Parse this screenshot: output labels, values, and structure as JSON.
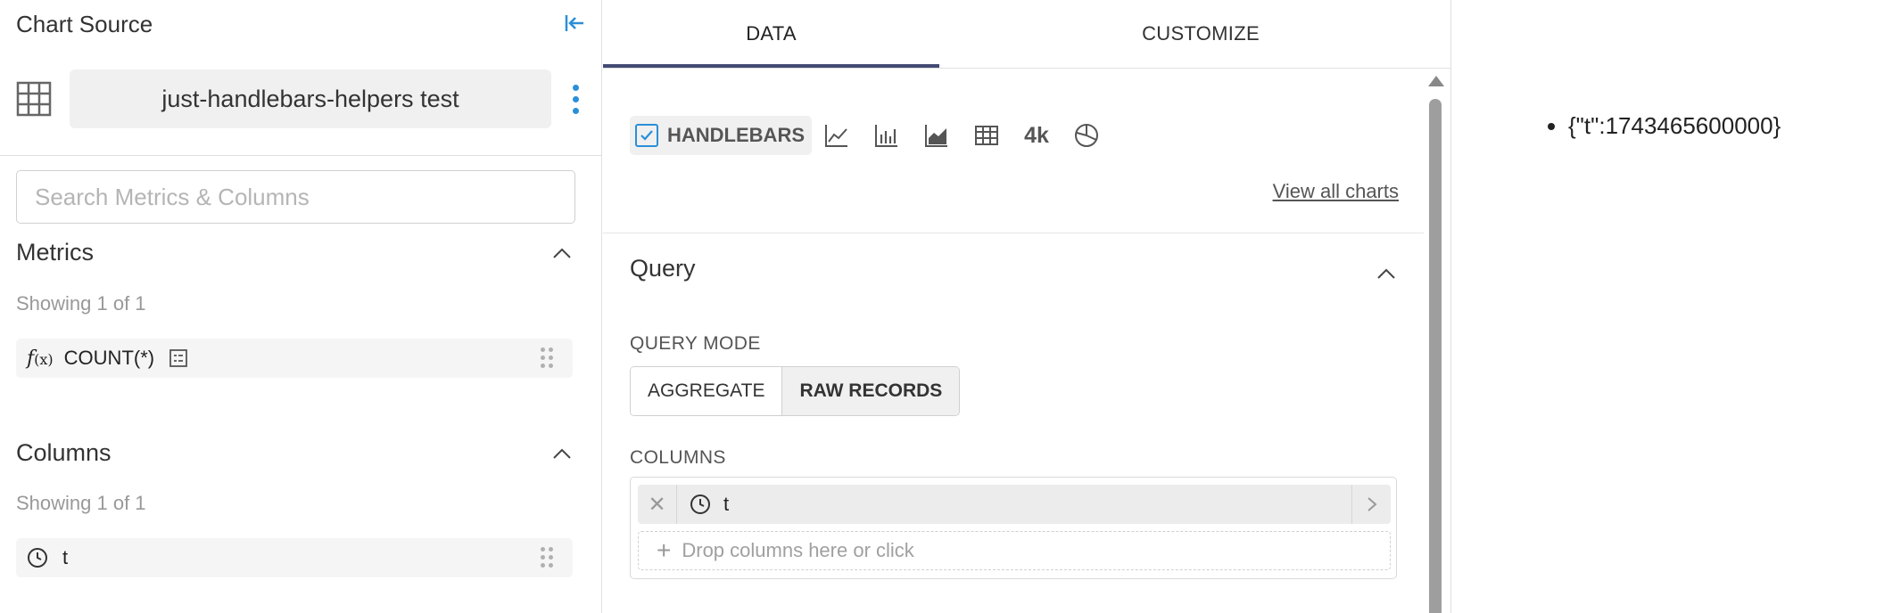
{
  "left_panel": {
    "title": "Chart Source",
    "datasource_name": "just-handlebars-helpers test",
    "search": {
      "placeholder": "Search Metrics & Columns",
      "value": ""
    },
    "metrics": {
      "title": "Metrics",
      "showing": "Showing 1 of 1",
      "items": [
        {
          "fx_label": "f",
          "fx_sub": "(x)",
          "label": "COUNT(*)"
        }
      ]
    },
    "columns": {
      "title": "Columns",
      "showing": "Showing 1 of 1",
      "items": [
        {
          "label": "t"
        }
      ]
    }
  },
  "middle_panel": {
    "tabs": [
      {
        "label": "DATA",
        "active": true
      },
      {
        "label": "CUSTOMIZE",
        "active": false
      }
    ],
    "viz": {
      "selected_label": "HANDLEBARS",
      "big_number_label": "4k",
      "view_all": "View all charts"
    },
    "query": {
      "title": "Query",
      "mode_label": "QUERY MODE",
      "modes": [
        {
          "label": "AGGREGATE",
          "active": false
        },
        {
          "label": "RAW RECORDS",
          "active": true
        }
      ],
      "columns_label": "COLUMNS",
      "column_chips": [
        {
          "label": "t"
        }
      ],
      "drop_placeholder": "Drop columns here or click"
    }
  },
  "preview": {
    "items": [
      "{\"t\":1743465600000}"
    ]
  },
  "colors": {
    "accent_blue": "#2a8fd8",
    "tab_underline": "#434a72",
    "chip_bg": "#ececec"
  }
}
